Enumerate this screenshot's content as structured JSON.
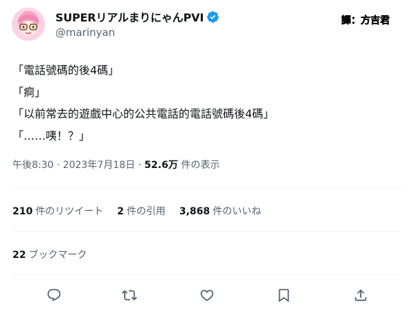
{
  "user": {
    "display_name": "SUPERリアルまりにゃんPVI",
    "handle": "@marinyan",
    "verified": true
  },
  "translator_label": "譯：方吉君",
  "tweet": {
    "lines": [
      "「電話號碼的後4碼」",
      "「痾」",
      "「以前常去的遊戲中心的公共電話的電話號碼後4碼」",
      "「……咦！？」"
    ]
  },
  "meta": {
    "time": "午後8:30",
    "separator": " · ",
    "date": "2023年7月18日",
    "views_count": "52.6万",
    "views_label": " 件の表示"
  },
  "stats": {
    "retweets_count": "210",
    "retweets_label": "件のリツイート",
    "quotes_count": "2",
    "quotes_label": "件の引用",
    "likes_count": "3,868",
    "likes_label": "件のいいね"
  },
  "bookmarks": {
    "count": "22",
    "label": "ブックマーク"
  },
  "icons": {
    "reply": "reply-icon",
    "retweet": "retweet-icon",
    "like": "heart-icon",
    "bookmark": "bookmark-icon",
    "share": "share-icon",
    "verified": "verified-badge-icon"
  },
  "colors": {
    "verified": "#1d9bf0",
    "secondary_text": "#536471",
    "primary_text": "#0f1419",
    "divider": "#eff3f4"
  }
}
